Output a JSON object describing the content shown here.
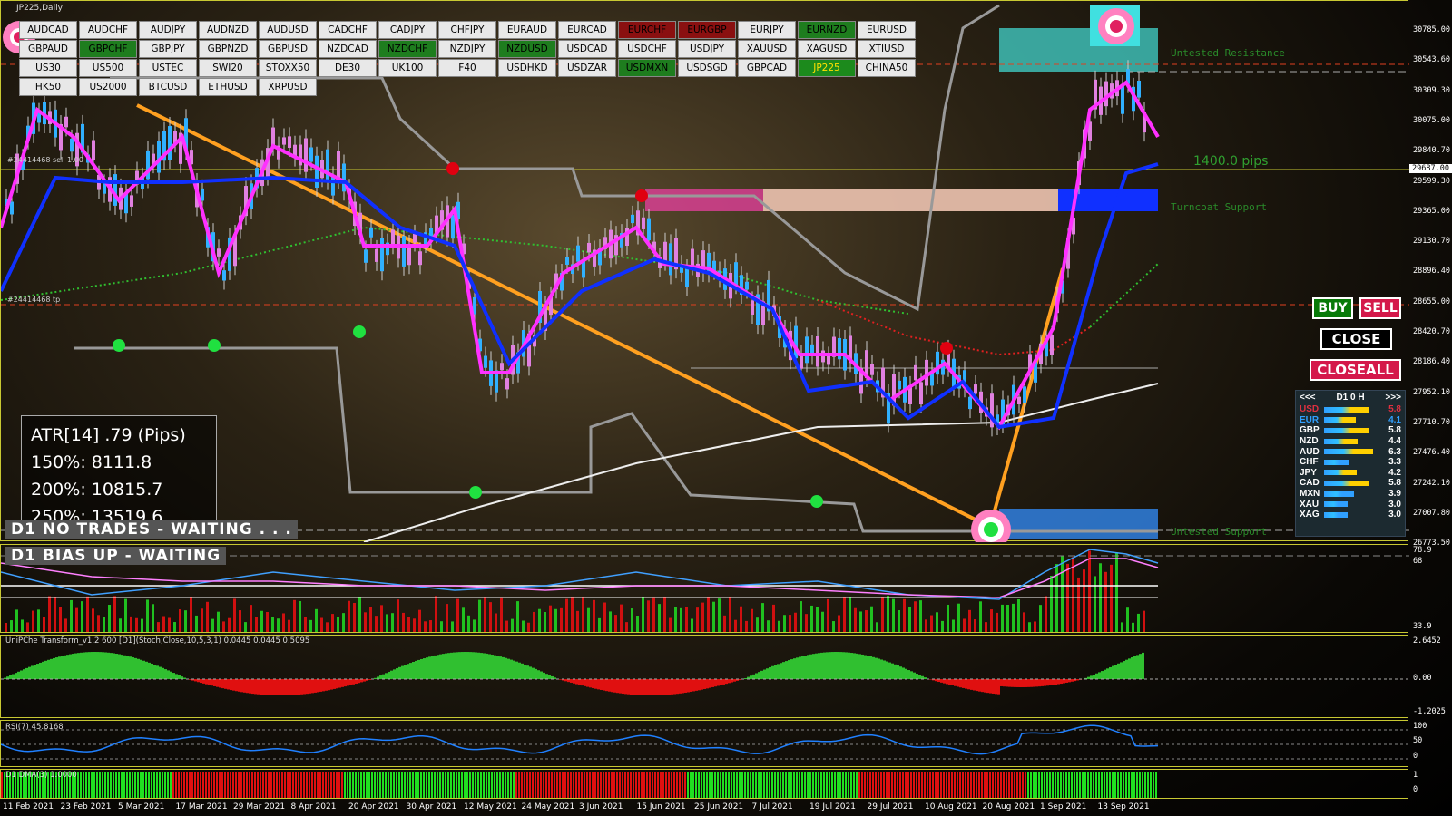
{
  "window": {
    "title": "JP225,Daily"
  },
  "symbols": [
    {
      "label": "AUDCAD",
      "state": "normal"
    },
    {
      "label": "AUDCHF",
      "state": "normal"
    },
    {
      "label": "AUDJPY",
      "state": "normal"
    },
    {
      "label": "AUDNZD",
      "state": "normal"
    },
    {
      "label": "AUDUSD",
      "state": "normal"
    },
    {
      "label": "CADCHF",
      "state": "normal"
    },
    {
      "label": "CADJPY",
      "state": "normal"
    },
    {
      "label": "CHFJPY",
      "state": "normal"
    },
    {
      "label": "EURAUD",
      "state": "normal"
    },
    {
      "label": "EURCAD",
      "state": "normal"
    },
    {
      "label": "EURCHF",
      "state": "red"
    },
    {
      "label": "EURGBP",
      "state": "red"
    },
    {
      "label": "EURJPY",
      "state": "normal"
    },
    {
      "label": "EURNZD",
      "state": "green"
    },
    {
      "label": "EURUSD",
      "state": "normal"
    },
    {
      "label": "GBPAUD",
      "state": "normal"
    },
    {
      "label": "GBPCHF",
      "state": "green"
    },
    {
      "label": "GBPJPY",
      "state": "normal"
    },
    {
      "label": "GBPNZD",
      "state": "normal"
    },
    {
      "label": "GBPUSD",
      "state": "normal"
    },
    {
      "label": "NZDCAD",
      "state": "normal"
    },
    {
      "label": "NZDCHF",
      "state": "green"
    },
    {
      "label": "NZDJPY",
      "state": "normal"
    },
    {
      "label": "NZDUSD",
      "state": "green"
    },
    {
      "label": "USDCAD",
      "state": "normal"
    },
    {
      "label": "USDCHF",
      "state": "normal"
    },
    {
      "label": "USDJPY",
      "state": "normal"
    },
    {
      "label": "XAUUSD",
      "state": "normal"
    },
    {
      "label": "XAGUSD",
      "state": "normal"
    },
    {
      "label": "XTIUSD",
      "state": "normal"
    },
    {
      "label": "US30",
      "state": "normal"
    },
    {
      "label": "US500",
      "state": "normal"
    },
    {
      "label": "USTEC",
      "state": "normal"
    },
    {
      "label": "SWI20",
      "state": "normal"
    },
    {
      "label": "STOXX50",
      "state": "normal"
    },
    {
      "label": "DE30",
      "state": "normal"
    },
    {
      "label": "UK100",
      "state": "normal"
    },
    {
      "label": "F40",
      "state": "normal"
    },
    {
      "label": "USDHKD",
      "state": "normal"
    },
    {
      "label": "USDZAR",
      "state": "normal"
    },
    {
      "label": "USDMXN",
      "state": "green"
    },
    {
      "label": "USDSGD",
      "state": "normal"
    },
    {
      "label": "GBPCAD",
      "state": "normal"
    },
    {
      "label": "JP225",
      "state": "lime"
    },
    {
      "label": "CHINA50",
      "state": "normal"
    },
    {
      "label": "HK50",
      "state": "normal"
    },
    {
      "label": "US2000",
      "state": "normal"
    },
    {
      "label": "BTCUSD",
      "state": "normal"
    },
    {
      "label": "ETHUSD",
      "state": "normal"
    },
    {
      "label": "XRPUSD",
      "state": "normal"
    }
  ],
  "order_lines": {
    "sell": "#24414468 sell 1.00",
    "tp": "#24414468 tp"
  },
  "atr": {
    "line1": "ATR[14] .79  (Pips)",
    "line2": "150%: 8111.8",
    "line3": "200%: 10815.7",
    "line4": "250%: 13519.6"
  },
  "banners": {
    "trades": "D1  NO TRADES - WAITING . . .",
    "bias": "D1  BIAS UP - WAITING"
  },
  "zones": {
    "resistance": "Untested Resistance",
    "turncoat": "Turncoat Support",
    "support": "Untested Support",
    "pips": "1400.0 pips"
  },
  "buttons": {
    "buy": "BUY",
    "sell": "SELL",
    "close": "CLOSE",
    "closeall": "CLOSEALL"
  },
  "strength": {
    "prev": "<<<",
    "period": "D1  0  H",
    "next": ">>>",
    "rows": [
      {
        "cur": "USD",
        "val": "5.8",
        "color": "#e03040",
        "bar": "#ffd000"
      },
      {
        "cur": "EUR",
        "val": "4.1",
        "color": "#30a0ff",
        "bar": "#ffd000"
      },
      {
        "cur": "GBP",
        "val": "5.8",
        "color": "#ffffff",
        "bar": "#ffd000"
      },
      {
        "cur": "NZD",
        "val": "4.4",
        "color": "#ffffff",
        "bar": "#ffd000"
      },
      {
        "cur": "AUD",
        "val": "6.3",
        "color": "#ffffff",
        "bar": "#ffd000"
      },
      {
        "cur": "CHF",
        "val": "3.3",
        "color": "#ffffff",
        "bar": "#30a0ff"
      },
      {
        "cur": "JPY",
        "val": "4.2",
        "color": "#ffffff",
        "bar": "#ffd000"
      },
      {
        "cur": "CAD",
        "val": "5.8",
        "color": "#ffffff",
        "bar": "#ffd000"
      },
      {
        "cur": "MXN",
        "val": "3.9",
        "color": "#ffffff",
        "bar": "#30a0ff"
      },
      {
        "cur": "XAU",
        "val": "3.0",
        "color": "#ffffff",
        "bar": "#30a0ff"
      },
      {
        "cur": "XAG",
        "val": "3.0",
        "color": "#ffffff",
        "bar": "#30a0ff"
      }
    ]
  },
  "price_axis": [
    "30785.00",
    "30543.60",
    "30309.30",
    "30075.00",
    "29840.70",
    "29599.30",
    "29365.00",
    "29130.70",
    "28896.40",
    "28655.00",
    "28420.70",
    "28186.40",
    "27952.10",
    "27710.70",
    "27476.40",
    "27242.10",
    "27007.80",
    "26773.50"
  ],
  "current_price": "29687.00",
  "ind1": {
    "axis": [
      "78.9",
      "68",
      "33.9"
    ]
  },
  "ind2": {
    "title": "UniPChe Transform_v1.2 600 [D1](Stoch,Close,10,5,3,1) 0.0445 0.0445 0.5095",
    "axis": [
      "2.6452",
      "0.00",
      "-1.2025"
    ]
  },
  "ind3": {
    "title": "RSI(7) 45.8168",
    "axis": [
      "100",
      "50",
      "0"
    ]
  },
  "ind4": {
    "title": "D1 DMA(3) 1.0000",
    "axis": [
      "1",
      "0"
    ]
  },
  "time_axis": [
    "11 Feb 2021",
    "23 Feb 2021",
    "5 Mar 2021",
    "17 Mar 2021",
    "29 Mar 2021",
    "8 Apr 2021",
    "20 Apr 2021",
    "30 Apr 2021",
    "12 May 2021",
    "24 May 2021",
    "3 Jun 2021",
    "15 Jun 2021",
    "25 Jun 2021",
    "7 Jul 2021",
    "19 Jul 2021",
    "29 Jul 2021",
    "10 Aug 2021",
    "20 Aug 2021",
    "1 Sep 2021",
    "13 Sep 2021"
  ],
  "colors": {
    "pane_border": "#c8c832",
    "fast_ma": "#ff30ff",
    "slow_ma": "#1030ff",
    "trend": "#ffa020",
    "buy": "#087a08",
    "sell": "#d4184a"
  }
}
